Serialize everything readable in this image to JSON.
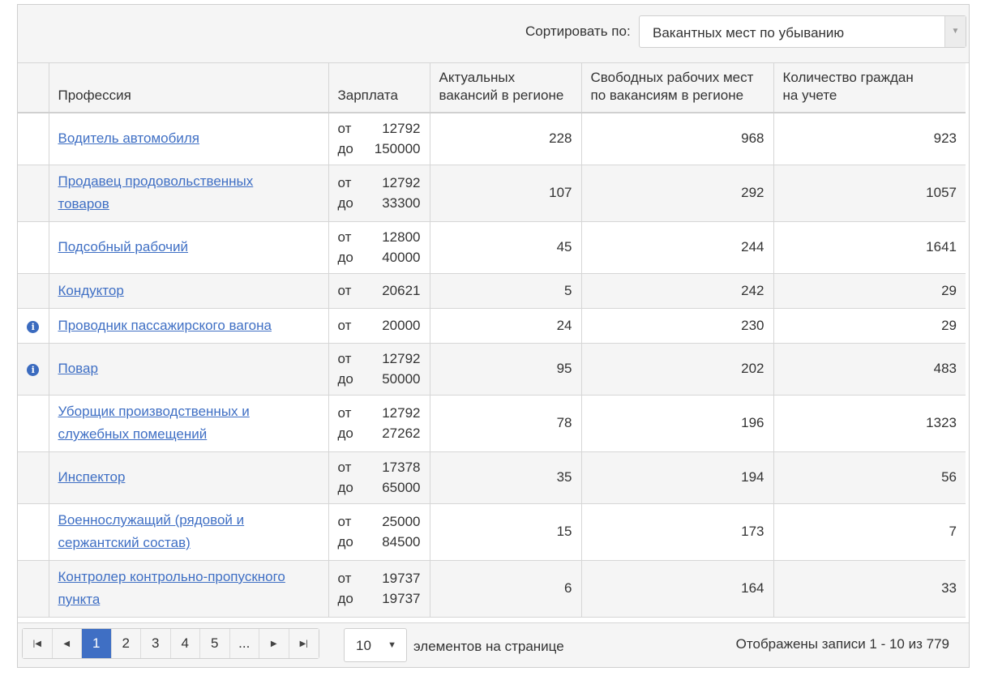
{
  "toolbar": {
    "sort_label": "Сортировать по:",
    "sort_value": "Вакантных мест по убыванию"
  },
  "table": {
    "headers": {
      "profession": "Профессия",
      "salary": "Зарплата",
      "vacancies_line1": "Актуальных",
      "vacancies_line2": "вакансий в регионе",
      "free_places_line1": "Свободных рабочих мест",
      "free_places_line2": "по вакансиям в регионе",
      "citizens_line1": "Количество граждан",
      "citizens_line2": "на учете"
    },
    "salary_from_label": "от",
    "salary_to_label": "до",
    "rows": [
      {
        "info": false,
        "name_line1": "Водитель автомобиля",
        "name_line2": "",
        "salary_from": "12792",
        "salary_to": "150000",
        "vacancies": "228",
        "free_places": "968",
        "citizens": "923"
      },
      {
        "info": false,
        "name_line1": "Продавец продовольственных",
        "name_line2": "товаров",
        "salary_from": "12792",
        "salary_to": "33300",
        "vacancies": "107",
        "free_places": "292",
        "citizens": "1057"
      },
      {
        "info": false,
        "name_line1": "Подсобный рабочий",
        "name_line2": "",
        "salary_from": "12800",
        "salary_to": "40000",
        "vacancies": "45",
        "free_places": "244",
        "citizens": "1641"
      },
      {
        "info": false,
        "name_line1": "Кондуктор",
        "name_line2": "",
        "salary_from": "20621",
        "salary_to": "",
        "vacancies": "5",
        "free_places": "242",
        "citizens": "29"
      },
      {
        "info": true,
        "name_line1": "Проводник пассажирского вагона",
        "name_line2": "",
        "salary_from": "20000",
        "salary_to": "",
        "vacancies": "24",
        "free_places": "230",
        "citizens": "29"
      },
      {
        "info": true,
        "name_line1": "Повар",
        "name_line2": "",
        "salary_from": "12792",
        "salary_to": "50000",
        "vacancies": "95",
        "free_places": "202",
        "citizens": "483"
      },
      {
        "info": false,
        "name_line1": "Уборщик производственных и",
        "name_line2": "служебных помещений",
        "salary_from": "12792",
        "salary_to": "27262",
        "vacancies": "78",
        "free_places": "196",
        "citizens": "1323"
      },
      {
        "info": false,
        "name_line1": "Инспектор",
        "name_line2": "",
        "salary_from": "17378",
        "salary_to": "65000",
        "vacancies": "35",
        "free_places": "194",
        "citizens": "56"
      },
      {
        "info": false,
        "name_line1": "Военнослужащий (рядовой и",
        "name_line2": "сержантский состав)",
        "salary_from": "25000",
        "salary_to": "84500",
        "vacancies": "15",
        "free_places": "173",
        "citizens": "7"
      },
      {
        "info": false,
        "name_line1": "Контролер контрольно-пропускного",
        "name_line2": "пункта",
        "salary_from": "19737",
        "salary_to": "19737",
        "vacancies": "6",
        "free_places": "164",
        "citizens": "33"
      }
    ]
  },
  "pager": {
    "first_icon": "first-page-icon",
    "prev_icon": "prev-page-icon",
    "next_icon": "next-page-icon",
    "last_icon": "last-page-icon",
    "pages": [
      "1",
      "2",
      "3",
      "4",
      "5",
      "..."
    ],
    "active_page": "1",
    "page_size": "10",
    "per_page_label": "элементов на странице",
    "records_info": "Отображены записи 1 - 10 из 779"
  },
  "colors": {
    "link": "#3f6fc4",
    "active_page": "#3f6fc4",
    "info_icon": "#3b6bbf",
    "stripe": "#f5f5f5"
  }
}
